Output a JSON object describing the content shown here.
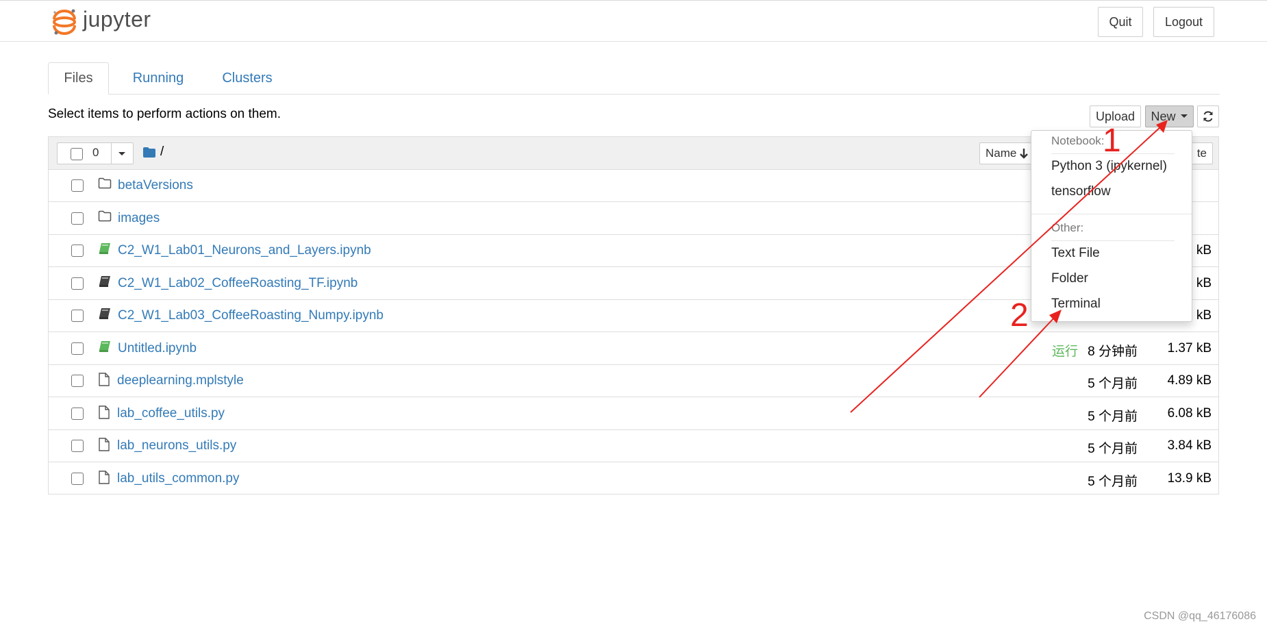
{
  "header": {
    "logo_text": "jupyter",
    "quit_label": "Quit",
    "logout_label": "Logout"
  },
  "tabs": [
    {
      "label": "Files",
      "active": true
    },
    {
      "label": "Running",
      "active": false
    },
    {
      "label": "Clusters",
      "active": false
    }
  ],
  "toolbar": {
    "instructions": "Select items to perform actions on them.",
    "upload_label": "Upload",
    "new_label": "New"
  },
  "list_header": {
    "selected_count": "0",
    "breadcrumb": "/",
    "sort_name_label": "Name",
    "sort_partial_label": "te"
  },
  "files": [
    {
      "type": "folder",
      "name": "betaVersions",
      "status": "",
      "modified": "",
      "size": ""
    },
    {
      "type": "folder",
      "name": "images",
      "status": "",
      "modified": "",
      "size": ""
    },
    {
      "type": "notebook-running",
      "name": "C2_W1_Lab01_Neurons_and_Layers.ipynb",
      "status": "",
      "modified": "",
      "size": "kB"
    },
    {
      "type": "notebook",
      "name": "C2_W1_Lab02_CoffeeRoasting_TF.ipynb",
      "status": "",
      "modified": "",
      "size": "kB"
    },
    {
      "type": "notebook",
      "name": "C2_W1_Lab03_CoffeeRoasting_Numpy.ipynb",
      "status": "",
      "modified": "",
      "size": "kB"
    },
    {
      "type": "notebook-running",
      "name": "Untitled.ipynb",
      "status": "运行",
      "modified": "8 分钟前",
      "size": "1.37 kB"
    },
    {
      "type": "file",
      "name": "deeplearning.mplstyle",
      "status": "",
      "modified": "5 个月前",
      "size": "4.89 kB"
    },
    {
      "type": "file",
      "name": "lab_coffee_utils.py",
      "status": "",
      "modified": "5 个月前",
      "size": "6.08 kB"
    },
    {
      "type": "file",
      "name": "lab_neurons_utils.py",
      "status": "",
      "modified": "5 个月前",
      "size": "3.84 kB"
    },
    {
      "type": "file",
      "name": "lab_utils_common.py",
      "status": "",
      "modified": "5 个月前",
      "size": "13.9 kB"
    }
  ],
  "new_menu": {
    "notebook_header": "Notebook:",
    "notebook_items": [
      "Python 3 (ipykernel)",
      "tensorflow"
    ],
    "other_header": "Other:",
    "other_items": [
      "Text File",
      "Folder",
      "Terminal"
    ]
  },
  "annotations": {
    "step1": "1",
    "step2": "2",
    "color": "#e8221f"
  },
  "watermark": "CSDN @qq_46176086",
  "colors": {
    "link": "#337ab7",
    "running": "#5cb85c",
    "notebook_running_icon": "#5cb85c",
    "logo_orange": "#f37726"
  }
}
